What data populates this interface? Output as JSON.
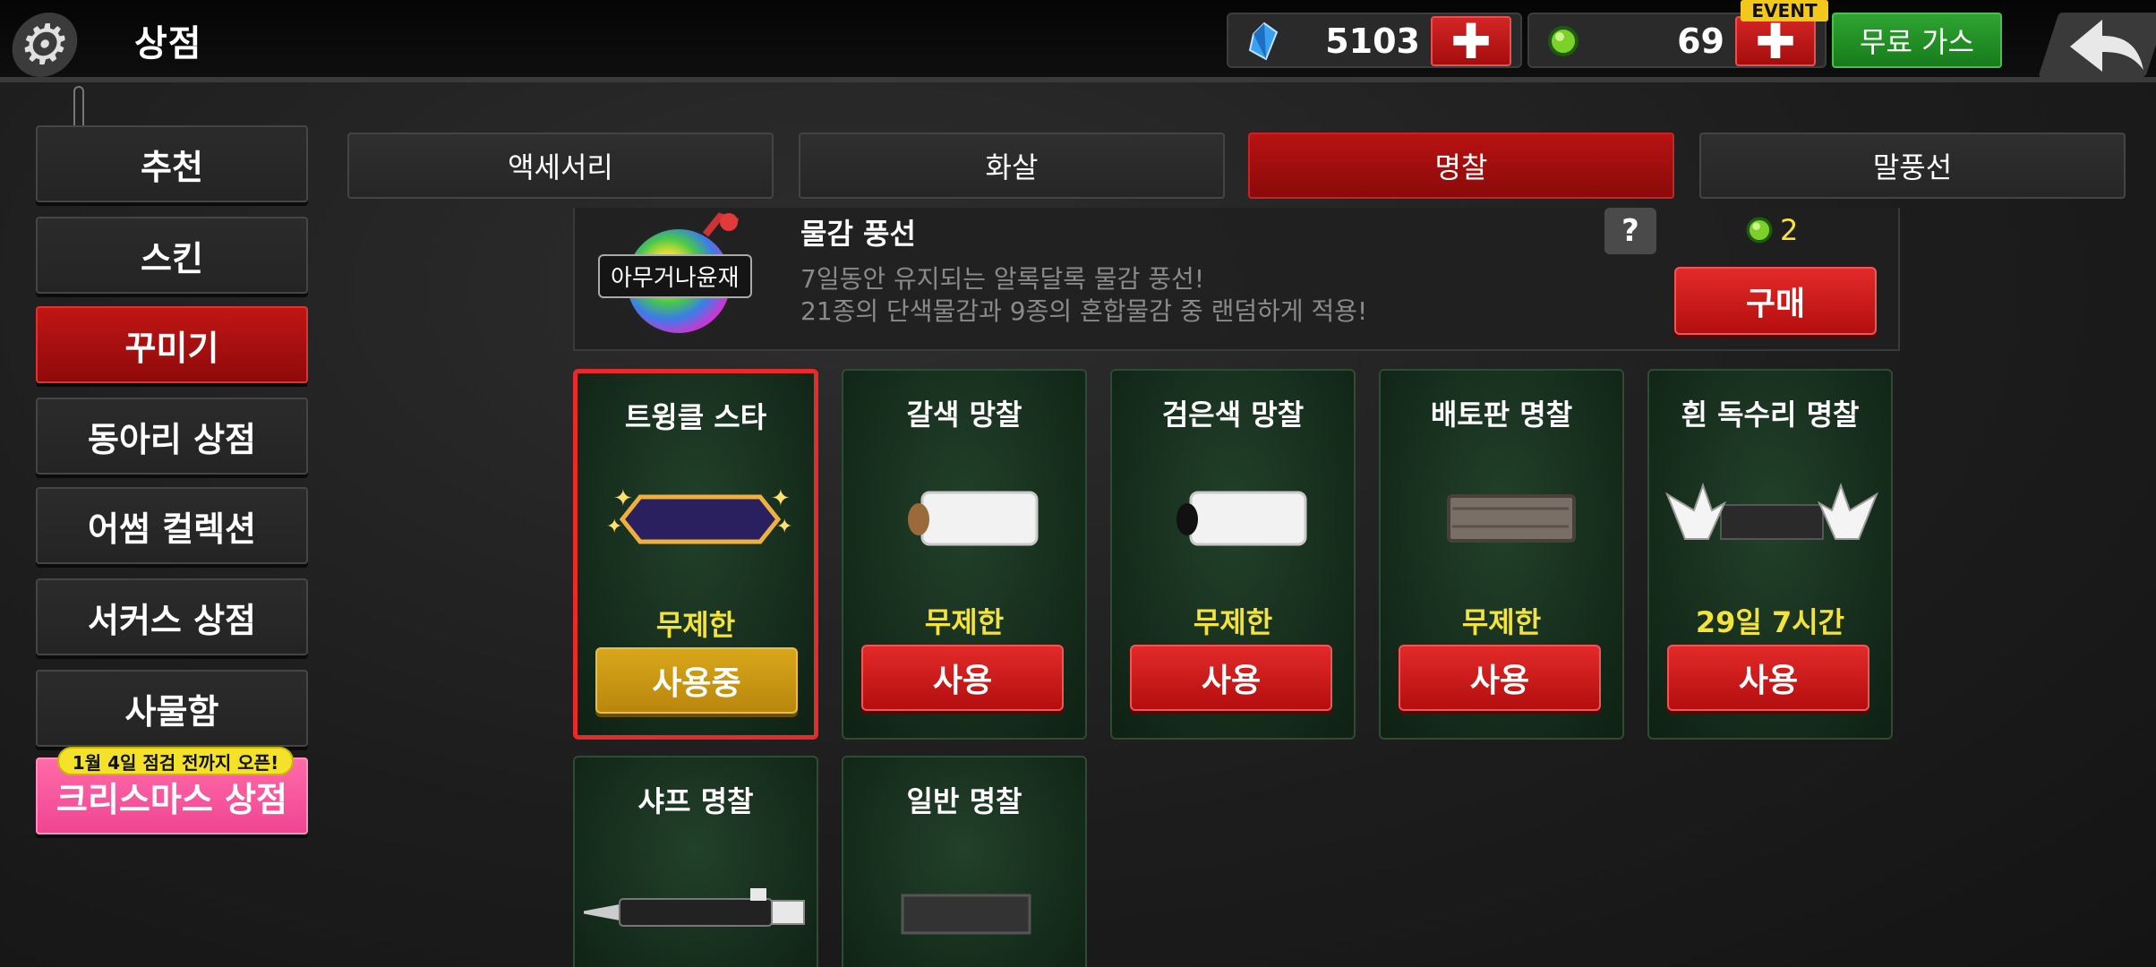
{
  "header": {
    "title": "상점",
    "crystal_value": "5103",
    "gem_value": "69",
    "event_tag": "EVENT",
    "free_gas_label": "무료 가스",
    "plus_symbol": "✚"
  },
  "sidebar": {
    "items": [
      {
        "label": "추천"
      },
      {
        "label": "스킨"
      },
      {
        "label": "꾸미기"
      },
      {
        "label": "동아리 상점"
      },
      {
        "label": "어썸 컬렉션"
      },
      {
        "label": "서커스 상점"
      },
      {
        "label": "사물함"
      },
      {
        "label": "크리스마스 상점"
      }
    ],
    "badge": "1월 4일 점검 전까지 오픈!"
  },
  "tabs": [
    {
      "label": "액세서리"
    },
    {
      "label": "화살"
    },
    {
      "label": "명찰"
    },
    {
      "label": "말풍선"
    }
  ],
  "banner": {
    "tag": "아무거나윤재",
    "title": "물감 풍선",
    "desc_line1": "7일동안 유지되는 알록달록 물감 풍선!",
    "desc_line2": "21종의 단색물감과 9종의 혼합물감 중 랜덤하게 적용!",
    "help": "?",
    "price": "2",
    "buy_label": "구매"
  },
  "cards": [
    {
      "name": "트윙클 스타",
      "duration": "무제한",
      "button": "사용중"
    },
    {
      "name": "갈색 망찰",
      "duration": "무제한",
      "button": "사용"
    },
    {
      "name": "검은색 망찰",
      "duration": "무제한",
      "button": "사용"
    },
    {
      "name": "배토판 명찰",
      "duration": "무제한",
      "button": "사용"
    },
    {
      "name": "흰 독수리 명찰",
      "duration": "29일 7시간",
      "button": "사용"
    },
    {
      "name": "샤프 명찰"
    },
    {
      "name": "일반 명찰"
    }
  ],
  "colors": {
    "accent_red": "#b81212",
    "gold": "#f3e33a",
    "in_use": "#d9a61a",
    "green": "#2fa332",
    "pink": "#f04593"
  }
}
